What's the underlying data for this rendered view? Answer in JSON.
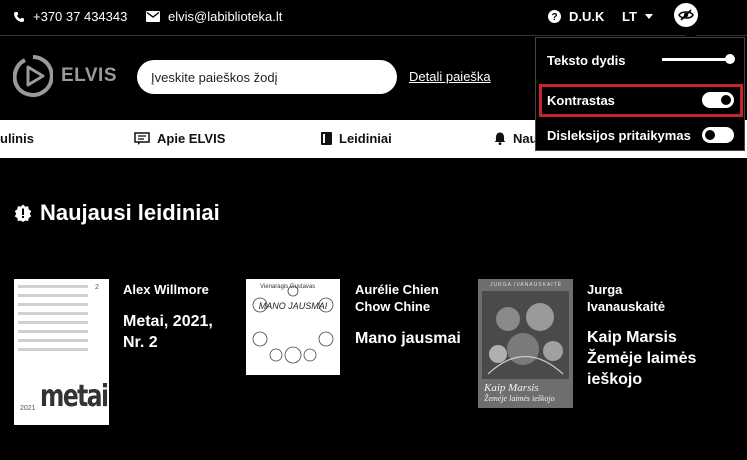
{
  "topbar": {
    "phone": "+370 37 434343",
    "email": "elvis@labiblioteka.lt",
    "faq": "D.U.K",
    "language": "LT",
    "phone_icon": "phone-icon",
    "email_icon": "envelope-icon",
    "faq_icon": "question-circle-icon",
    "a11y_icon": "eye-slash-icon"
  },
  "header": {
    "logo_text": "ELVIS",
    "search_placeholder": "Įveskite paieškos žodį",
    "advanced_search": "Detali paieška"
  },
  "nav": {
    "items": [
      {
        "label": "ulinis",
        "icon": ""
      },
      {
        "label": "Apie ELVIS",
        "icon": "message-icon"
      },
      {
        "label": "Leidiniai",
        "icon": "book-icon"
      },
      {
        "label": "Nau",
        "icon": "bell-icon"
      }
    ]
  },
  "section": {
    "title": "Naujausi leidiniai",
    "icon": "badge-alert-icon"
  },
  "cards": [
    {
      "author": "Alex Willmore",
      "title_lines": [
        "Metai, 2021,",
        "Nr. 2"
      ],
      "cover_brand": "metai",
      "cover_year": "2021",
      "cover_num": "2"
    },
    {
      "author_lines": [
        "Aurélie Chien",
        "Chow Chine"
      ],
      "title": "Mano jausmai",
      "cover_top": "Vienaragis Gustavas",
      "cover_main": "MANO JAUSMAI"
    },
    {
      "author_lines": [
        "Jurga",
        "Ivanauskaitė"
      ],
      "title_lines": [
        "Kaip Marsis",
        "Žemėje laimės",
        "ieškojo"
      ],
      "cover_head": "JURGA IVANAUSKAITĖ",
      "cover_t1": "Kaip Marsis",
      "cover_t2": "Žemėje laimės ieškojo"
    }
  ],
  "a11y_panel": {
    "text_size_label": "Teksto dydis",
    "text_size_level": 1.0,
    "contrast_label": "Kontrastas",
    "contrast_on": true,
    "dyslexia_label": "Disleksijos pritaikymas",
    "dyslexia_on": false,
    "highlight_color": "#c8222b"
  }
}
